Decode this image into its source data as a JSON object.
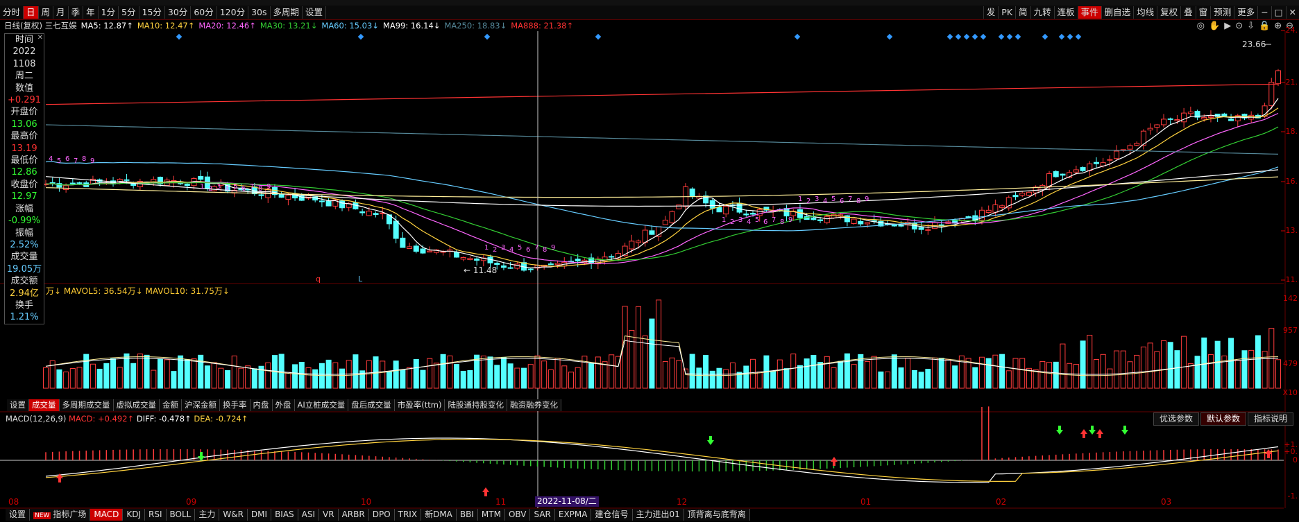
{
  "toolbar": {
    "items": [
      "分时",
      "日",
      "周",
      "月",
      "季",
      "年",
      "1分",
      "5分",
      "15分",
      "30分",
      "60分",
      "120分",
      "30s",
      "多周期",
      "设置"
    ],
    "right_items": [
      "发",
      "PK",
      "简",
      "九转",
      "连板",
      "事件",
      "删自选",
      "均线",
      "复权",
      "叠",
      "窗",
      "预测",
      "更多"
    ]
  },
  "ma_legend": {
    "title": "日线(复权) 三七互娱",
    "items": [
      {
        "text": "MA5: 12.87↑",
        "color": "#ffffff"
      },
      {
        "text": "MA10: 12.47↑",
        "color": "#ffd23f"
      },
      {
        "text": "MA20: 12.46↑",
        "color": "#ff66ff"
      },
      {
        "text": "MA30: 13.21↓",
        "color": "#33cc33"
      },
      {
        "text": "MA60: 15.03↓",
        "color": "#66ccff"
      },
      {
        "text": "MA99: 16.14↓",
        "color": "#ffffff"
      },
      {
        "text": "MA250: 18.83↓",
        "color": "#558899"
      },
      {
        "text": "MA888: 21.38↑",
        "color": "#ff3333"
      }
    ]
  },
  "info_panel": {
    "rows": [
      {
        "label": "时间",
        "value": "2022",
        "color": "#dddddd"
      },
      {
        "label": "",
        "value": "1108",
        "color": "#dddddd"
      },
      {
        "label": "周二",
        "value": "",
        "color": "#dddddd"
      },
      {
        "label": "数值",
        "value": "+0.291",
        "color": "#ff3333"
      },
      {
        "label": "开盘价",
        "value": "13.06",
        "color": "#33ff33"
      },
      {
        "label": "最高价",
        "value": "13.19",
        "color": "#ff3333"
      },
      {
        "label": "最低价",
        "value": "12.86",
        "color": "#33ff33"
      },
      {
        "label": "收盘价",
        "value": "12.97",
        "color": "#33ff33"
      },
      {
        "label": "涨幅",
        "value": "-0.99%",
        "color": "#33ff33"
      },
      {
        "label": "振幅",
        "value": "2.52%",
        "color": "#66ccff"
      },
      {
        "label": "成交量",
        "value": "19.05万",
        "color": "#66ccff"
      },
      {
        "label": "成交额",
        "value": "2.94亿",
        "color": "#ffd23f"
      },
      {
        "label": "换手",
        "value": "1.21%",
        "color": "#66ccff"
      }
    ]
  },
  "price_axis": [
    "24.",
    "21.",
    "18.",
    "16.",
    "13.",
    "11."
  ],
  "price_annotations": {
    "high": "23.66",
    "low": "11.48"
  },
  "vol_legend": {
    "text": "万↓ MAVOL5: 36.54万↓ MAVOL10: 31.75万↓"
  },
  "vol_axis": [
    "142",
    "957",
    "479",
    "X10"
  ],
  "vol_tabs": [
    "设置",
    "成交量",
    "多周期成交量",
    "虚拟成交量",
    "金额",
    "沪深金额",
    "换手率",
    "内盘",
    "外盘",
    "AI立桩成交量",
    "盘后成交量",
    "市盈率(ttm)",
    "陆股通持股变化",
    "融资融券变化"
  ],
  "macd_legend": {
    "name": "MACD(12,26,9)",
    "macd": "MACD: +0.492↑",
    "diff": "DIFF: -0.478↑",
    "dea": "DEA: -0.724↑"
  },
  "macd_buttons": [
    "优选参数",
    "默认参数",
    "指标说明"
  ],
  "macd_axis": [
    "+1.",
    "+0.",
    "0",
    "-1."
  ],
  "x_axis": [
    "08",
    "09",
    "10",
    "11",
    "12",
    "01",
    "02",
    "03"
  ],
  "crosshair_date": "2022-11-08/二",
  "bottom_tabs": [
    "设置",
    "指标广场",
    "MACD",
    "KDJ",
    "RSI",
    "BOLL",
    "主力",
    "W&R",
    "DMI",
    "BIAS",
    "ASI",
    "VR",
    "ARBR",
    "DPO",
    "TRIX",
    "新DMA",
    "BBI",
    "MTM",
    "OBV",
    "SAR",
    "EXPMA",
    "建仓信号",
    "主力进出01",
    "顶背离与底背离"
  ],
  "td_counts": {
    "top_left": [
      "4",
      "5",
      "6",
      "7",
      "8",
      "9"
    ],
    "down1": [
      "1",
      "2",
      "3",
      "4",
      "5",
      "6",
      "7",
      "8",
      "9"
    ],
    "up_mid": [
      "1",
      "2",
      "3",
      "4",
      "5",
      "6",
      "7",
      "8",
      "9"
    ],
    "up_right": [
      "1",
      "2",
      "3",
      "4",
      "5",
      "6",
      "7",
      "8",
      "9"
    ],
    "down2": [
      "1",
      "2",
      "3",
      "4",
      "5",
      "6",
      "7",
      "8",
      "9"
    ],
    "letters": [
      "q",
      "L"
    ]
  }
}
